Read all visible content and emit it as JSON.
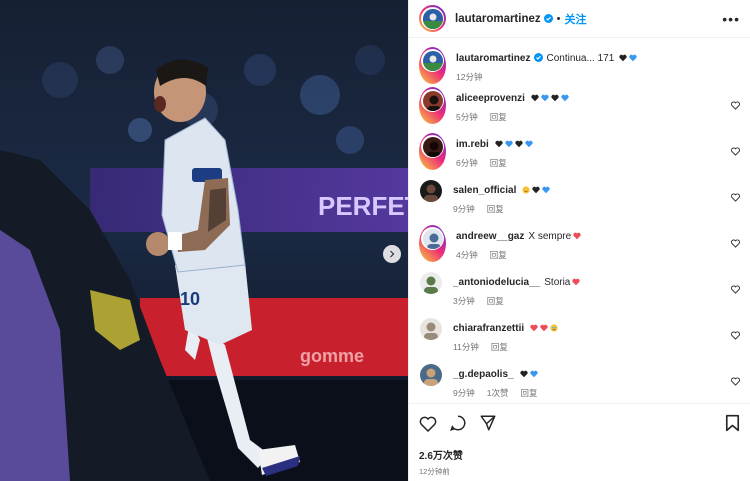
{
  "post": {
    "author": "lautaromartinez",
    "follow_label": "关注",
    "caption_author": "lautaromartinez",
    "caption_text": "Continua... 171",
    "caption_time": "12分钟",
    "likes": "2.6万次赞",
    "posted_ago": "12分钟前"
  },
  "media": {
    "board_text_1": "PERFETTI",
    "board_text_2": "gomme",
    "shirt_number": "10"
  },
  "reply_label": "回复",
  "comments": [
    {
      "user": "aliceeprovenzi",
      "text": "",
      "emojis": [
        "black",
        "blue",
        "black",
        "blue"
      ],
      "time": "5分钟",
      "extra": ""
    },
    {
      "user": "im.rebi",
      "text": "",
      "emojis": [
        "black",
        "blue",
        "black",
        "blue"
      ],
      "time": "6分钟",
      "extra": ""
    },
    {
      "user": "salen_official",
      "text": "",
      "emojis": [
        "smile",
        "black",
        "blue"
      ],
      "time": "9分钟",
      "extra": ""
    },
    {
      "user": "andreew__gaz",
      "text": "X sempre",
      "emojis": [
        "red"
      ],
      "time": "4分钟",
      "extra": ""
    },
    {
      "user": "_antoniodelucia__",
      "text": "Storia",
      "emojis": [
        "red"
      ],
      "time": "3分钟",
      "extra": ""
    },
    {
      "user": "chiarafranzettii",
      "text": "",
      "emojis": [
        "red",
        "red",
        "cry"
      ],
      "time": "11分钟",
      "extra": ""
    },
    {
      "user": "_g.depaolis_",
      "text": "",
      "emojis": [
        "black",
        "blue"
      ],
      "time": "9分钟",
      "extra": "1次赞"
    }
  ],
  "colors": {
    "link": "#0095f6",
    "text": "#262626",
    "muted": "#737373",
    "heart_red": "#ed4956",
    "heart_blue": "#3897f0"
  }
}
